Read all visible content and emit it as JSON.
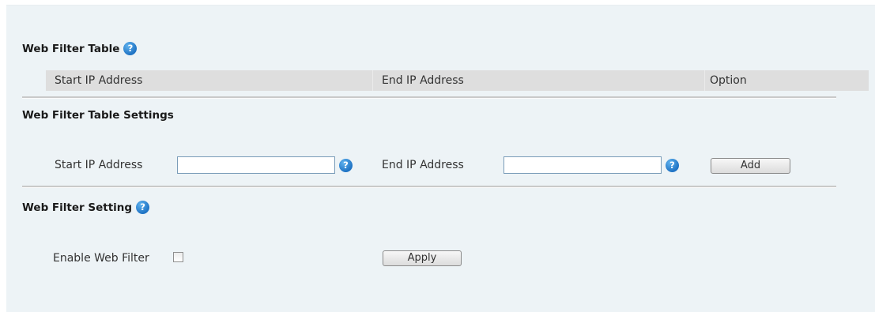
{
  "web_filter_table": {
    "title": "Web Filter Table",
    "help_icon": "question-circle-icon",
    "columns": [
      "Start IP Address",
      "End IP Address",
      "Option"
    ]
  },
  "web_filter_table_settings": {
    "title": "Web Filter Table Settings",
    "start_ip_label": "Start IP Address",
    "start_ip_value": "",
    "end_ip_label": "End IP Address",
    "end_ip_value": "",
    "add_button": "Add"
  },
  "web_filter_setting": {
    "title": "Web Filter Setting",
    "enable_label": "Enable Web Filter",
    "enable_checked": false,
    "apply_button": "Apply"
  },
  "help_glyph": "?",
  "colors": {
    "panel_bg": "#edf3f6",
    "table_header_bg": "#dedede",
    "help_icon": "#1f73c4"
  }
}
